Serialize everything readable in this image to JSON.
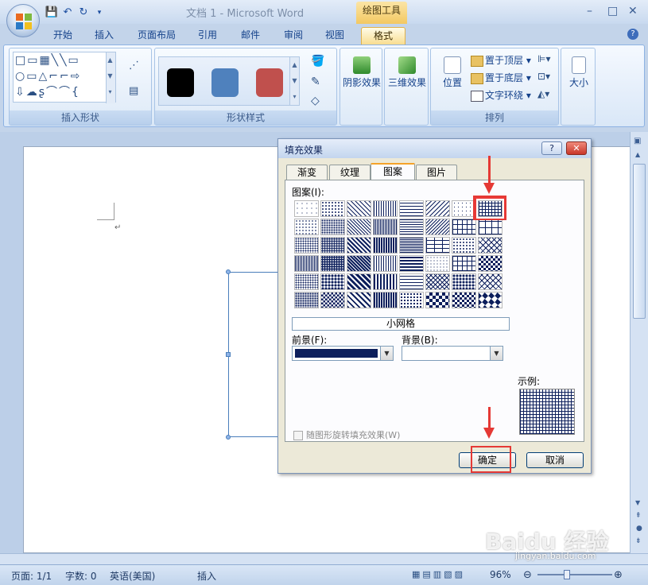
{
  "app": {
    "title": "文档 1 - Microsoft Word",
    "tools_title": "绘图工具",
    "minimize": "–",
    "maximize": "□",
    "close": "✕"
  },
  "tabs": [
    "开始",
    "插入",
    "页面布局",
    "引用",
    "邮件",
    "审阅",
    "视图",
    "格式"
  ],
  "active_tab": "格式",
  "ribbon": {
    "groups": {
      "insert_shapes": "插入形状",
      "shape_styles": "形状样式",
      "arrange": "排列"
    },
    "shadow_effects": "阴影效果",
    "3d_effects": "三维效果",
    "position": "位置",
    "bring_to_front": "置于顶层",
    "send_to_back": "置于底层",
    "text_wrapping": "文字环绕",
    "size": "大小",
    "style_colors": [
      "#000000",
      "#4f81bd",
      "#c0504d"
    ]
  },
  "dialog": {
    "title": "填充效果",
    "help_btn": "?",
    "close_btn": "✕",
    "tabs": [
      "渐变",
      "纹理",
      "图案",
      "图片"
    ],
    "active_tab": "图案",
    "pattern_label": "图案(I):",
    "selected_pattern_name": "小网格",
    "foreground_label": "前景(F):",
    "background_label": "背景(B):",
    "foreground_color": "#0d1f5c",
    "background_color": "#ffffff",
    "sample_label": "示例:",
    "rotate_checkbox": "随图形旋转填充效果(W)",
    "ok": "确定",
    "cancel": "取消"
  },
  "status": {
    "page": "页面: 1/1",
    "words": "字数: 0",
    "language": "英语(美国)",
    "mode": "插入",
    "zoom": "96%"
  },
  "watermark": {
    "brand": "Baidu 经验",
    "url": "jingyan.baidu.com"
  }
}
